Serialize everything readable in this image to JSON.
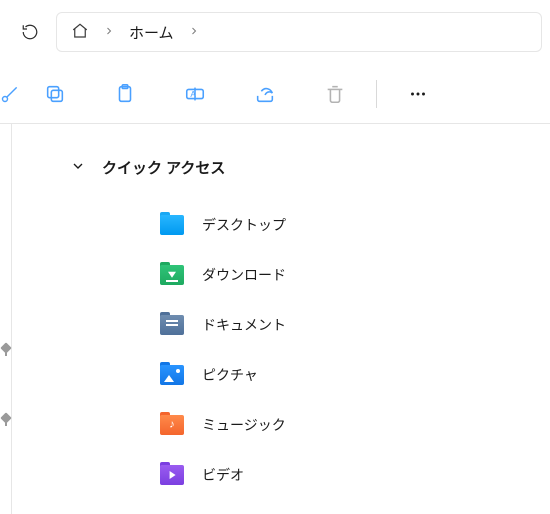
{
  "breadcrumb": {
    "current": "ホーム"
  },
  "section": {
    "title": "クイック アクセス"
  },
  "items": [
    {
      "label": "デスクトップ",
      "icon": "desk"
    },
    {
      "label": "ダウンロード",
      "icon": "dl"
    },
    {
      "label": "ドキュメント",
      "icon": "doc"
    },
    {
      "label": "ピクチャ",
      "icon": "pic"
    },
    {
      "label": "ミュージック",
      "icon": "mus"
    },
    {
      "label": "ビデオ",
      "icon": "vid"
    }
  ]
}
